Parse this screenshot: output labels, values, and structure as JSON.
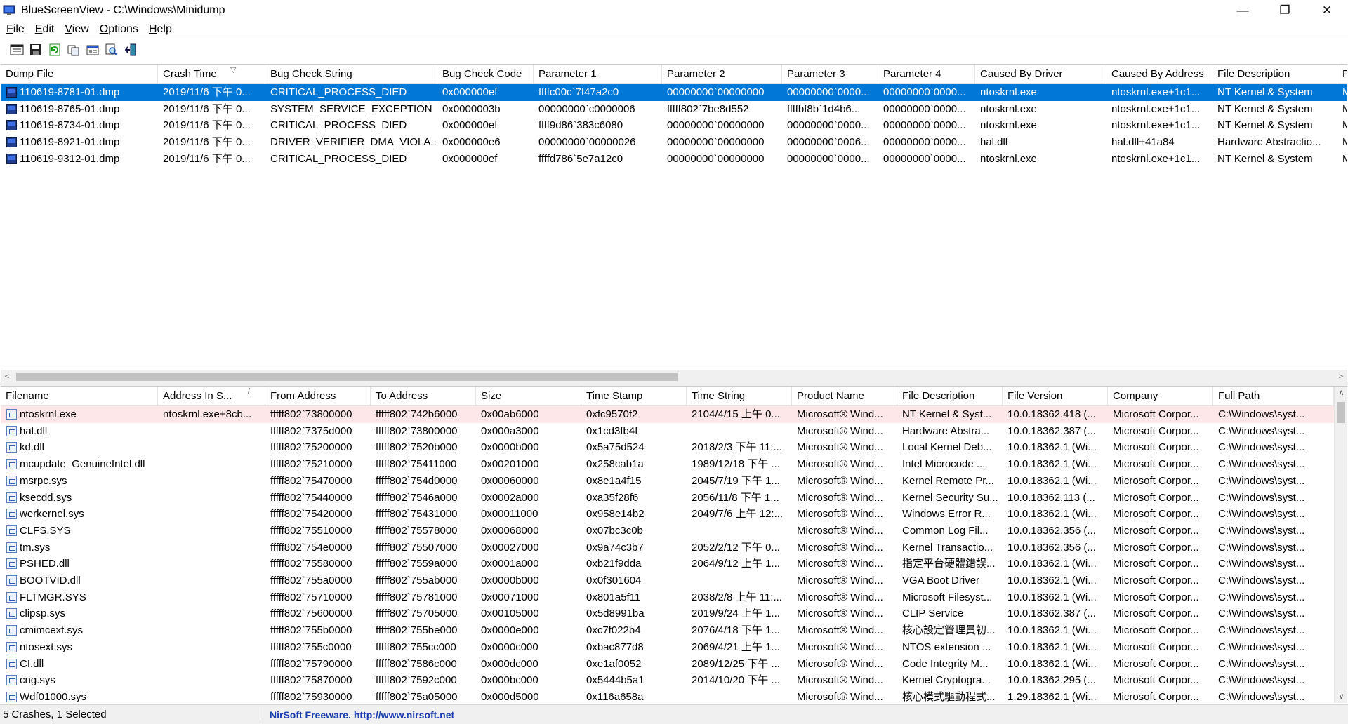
{
  "window": {
    "title": "BlueScreenView  -  C:\\Windows\\Minidump",
    "minimize_glyph": "—",
    "maximize_glyph": "❐",
    "close_glyph": "✕"
  },
  "menu": [
    {
      "mnemonic": "F",
      "rest": "ile"
    },
    {
      "mnemonic": "E",
      "rest": "dit"
    },
    {
      "mnemonic": "V",
      "rest": "iew"
    },
    {
      "mnemonic": "O",
      "rest": "ptions"
    },
    {
      "mnemonic": "H",
      "rest": "elp"
    }
  ],
  "toolbar_icons": [
    "html-report-icon",
    "save-icon",
    "refresh-icon",
    "copy-icon",
    "properties-icon",
    "find-icon",
    "exit-icon"
  ],
  "colors": {
    "selection": "#0078d7",
    "highlight_row": "#fde7e9",
    "link": "#1a3fb0"
  },
  "top_table": {
    "columns": [
      "Dump File",
      "Crash Time",
      "Bug Check String",
      "Bug Check Code",
      "Parameter 1",
      "Parameter 2",
      "Parameter 3",
      "Parameter 4",
      "Caused By Driver",
      "Caused By Address",
      "File Description",
      "P"
    ],
    "sorted_column": "Crash Time",
    "sort_glyph": "▽",
    "rows": [
      [
        "110619-8781-01.dmp",
        "2019/11/6 下午 0...",
        "CRITICAL_PROCESS_DIED",
        "0x000000ef",
        "ffffc00c`7f47a2c0",
        "00000000`00000000",
        "00000000`0000...",
        "00000000`0000...",
        "ntoskrnl.exe",
        "ntoskrnl.exe+1c1...",
        "NT Kernel & System",
        "M"
      ],
      [
        "110619-8765-01.dmp",
        "2019/11/6 下午 0...",
        "SYSTEM_SERVICE_EXCEPTION",
        "0x0000003b",
        "00000000`c0000006",
        "fffff802`7be8d552",
        "ffffbf8b`1d4b6...",
        "00000000`0000...",
        "ntoskrnl.exe",
        "ntoskrnl.exe+1c1...",
        "NT Kernel & System",
        "M"
      ],
      [
        "110619-8734-01.dmp",
        "2019/11/6 下午 0...",
        "CRITICAL_PROCESS_DIED",
        "0x000000ef",
        "ffff9d86`383c6080",
        "00000000`00000000",
        "00000000`0000...",
        "00000000`0000...",
        "ntoskrnl.exe",
        "ntoskrnl.exe+1c1...",
        "NT Kernel & System",
        "M"
      ],
      [
        "110619-8921-01.dmp",
        "2019/11/6 下午 0...",
        "DRIVER_VERIFIER_DMA_VIOLA...",
        "0x000000e6",
        "00000000`00000026",
        "00000000`00000000",
        "00000000`0006...",
        "00000000`0000...",
        "hal.dll",
        "hal.dll+41a84",
        "Hardware Abstractio...",
        "M"
      ],
      [
        "110619-9312-01.dmp",
        "2019/11/6 下午 0...",
        "CRITICAL_PROCESS_DIED",
        "0x000000ef",
        "ffffd786`5e7a12c0",
        "00000000`00000000",
        "00000000`0000...",
        "00000000`0000...",
        "ntoskrnl.exe",
        "ntoskrnl.exe+1c1...",
        "NT Kernel & System",
        "M"
      ]
    ]
  },
  "bottom_table": {
    "columns": [
      "Filename",
      "Address In S...",
      "From Address",
      "To Address",
      "Size",
      "Time Stamp",
      "Time String",
      "Product Name",
      "File Description",
      "File Version",
      "Company",
      "Full Path"
    ],
    "sorted_column": "Address In S...",
    "sort_glyph": "/",
    "rows": [
      [
        "ntoskrnl.exe",
        "ntoskrnl.exe+8cb...",
        "fffff802`73800000",
        "fffff802`742b6000",
        "0x00ab6000",
        "0xfc9570f2",
        "2104/4/15 上午 0...",
        "Microsoft® Wind...",
        "NT Kernel & Syst...",
        "10.0.18362.418 (...",
        "Microsoft Corpor...",
        "C:\\Windows\\syst..."
      ],
      [
        "hal.dll",
        "",
        "fffff802`7375d000",
        "fffff802`73800000",
        "0x000a3000",
        "0x1cd3fb4f",
        "",
        "Microsoft® Wind...",
        "Hardware Abstra...",
        "10.0.18362.387 (...",
        "Microsoft Corpor...",
        "C:\\Windows\\syst..."
      ],
      [
        "kd.dll",
        "",
        "fffff802`75200000",
        "fffff802`7520b000",
        "0x0000b000",
        "0x5a75d524",
        "2018/2/3 下午 11:...",
        "Microsoft® Wind...",
        "Local Kernel Deb...",
        "10.0.18362.1 (Wi...",
        "Microsoft Corpor...",
        "C:\\Windows\\syst..."
      ],
      [
        "mcupdate_GenuineIntel.dll",
        "",
        "fffff802`75210000",
        "fffff802`75411000",
        "0x00201000",
        "0x258cab1a",
        "1989/12/18 下午 ...",
        "Microsoft® Wind...",
        "Intel Microcode ...",
        "10.0.18362.1 (Wi...",
        "Microsoft Corpor...",
        "C:\\Windows\\syst..."
      ],
      [
        "msrpc.sys",
        "",
        "fffff802`75470000",
        "fffff802`754d0000",
        "0x00060000",
        "0x8e1a4f15",
        "2045/7/19 下午 1...",
        "Microsoft® Wind...",
        "Kernel Remote Pr...",
        "10.0.18362.1 (Wi...",
        "Microsoft Corpor...",
        "C:\\Windows\\syst..."
      ],
      [
        "ksecdd.sys",
        "",
        "fffff802`75440000",
        "fffff802`7546a000",
        "0x0002a000",
        "0xa35f28f6",
        "2056/11/8 下午 1...",
        "Microsoft® Wind...",
        "Kernel Security Su...",
        "10.0.18362.113 (...",
        "Microsoft Corpor...",
        "C:\\Windows\\syst..."
      ],
      [
        "werkernel.sys",
        "",
        "fffff802`75420000",
        "fffff802`75431000",
        "0x00011000",
        "0x958e14b2",
        "2049/7/6 上午 12:...",
        "Microsoft® Wind...",
        "Windows Error R...",
        "10.0.18362.1 (Wi...",
        "Microsoft Corpor...",
        "C:\\Windows\\syst..."
      ],
      [
        "CLFS.SYS",
        "",
        "fffff802`75510000",
        "fffff802`75578000",
        "0x00068000",
        "0x07bc3c0b",
        "",
        "Microsoft® Wind...",
        "Common Log Fil...",
        "10.0.18362.356 (...",
        "Microsoft Corpor...",
        "C:\\Windows\\syst..."
      ],
      [
        "tm.sys",
        "",
        "fffff802`754e0000",
        "fffff802`75507000",
        "0x00027000",
        "0x9a74c3b7",
        "2052/2/12 下午 0...",
        "Microsoft® Wind...",
        "Kernel Transactio...",
        "10.0.18362.356 (...",
        "Microsoft Corpor...",
        "C:\\Windows\\syst..."
      ],
      [
        "PSHED.dll",
        "",
        "fffff802`75580000",
        "fffff802`7559a000",
        "0x0001a000",
        "0xb21f9dda",
        "2064/9/12 上午 1...",
        "Microsoft® Wind...",
        "指定平台硬體錯誤...",
        "10.0.18362.1 (Wi...",
        "Microsoft Corpor...",
        "C:\\Windows\\syst..."
      ],
      [
        "BOOTVID.dll",
        "",
        "fffff802`755a0000",
        "fffff802`755ab000",
        "0x0000b000",
        "0x0f301604",
        "",
        "Microsoft® Wind...",
        "VGA Boot Driver",
        "10.0.18362.1 (Wi...",
        "Microsoft Corpor...",
        "C:\\Windows\\syst..."
      ],
      [
        "FLTMGR.SYS",
        "",
        "fffff802`75710000",
        "fffff802`75781000",
        "0x00071000",
        "0x801a5f11",
        "2038/2/8 上午 11:...",
        "Microsoft® Wind...",
        "Microsoft Filesyst...",
        "10.0.18362.1 (Wi...",
        "Microsoft Corpor...",
        "C:\\Windows\\syst..."
      ],
      [
        "clipsp.sys",
        "",
        "fffff802`75600000",
        "fffff802`75705000",
        "0x00105000",
        "0x5d8991ba",
        "2019/9/24 上午 1...",
        "Microsoft® Wind...",
        "CLIP Service",
        "10.0.18362.387 (...",
        "Microsoft Corpor...",
        "C:\\Windows\\syst..."
      ],
      [
        "cmimcext.sys",
        "",
        "fffff802`755b0000",
        "fffff802`755be000",
        "0x0000e000",
        "0xc7f022b4",
        "2076/4/18 下午 1...",
        "Microsoft® Wind...",
        "核心設定管理員初...",
        "10.0.18362.1 (Wi...",
        "Microsoft Corpor...",
        "C:\\Windows\\syst..."
      ],
      [
        "ntosext.sys",
        "",
        "fffff802`755c0000",
        "fffff802`755cc000",
        "0x0000c000",
        "0xbac877d8",
        "2069/4/21 上午 1...",
        "Microsoft® Wind...",
        "NTOS extension ...",
        "10.0.18362.1 (Wi...",
        "Microsoft Corpor...",
        "C:\\Windows\\syst..."
      ],
      [
        "CI.dll",
        "",
        "fffff802`75790000",
        "fffff802`7586c000",
        "0x000dc000",
        "0xe1af0052",
        "2089/12/25 下午 ...",
        "Microsoft® Wind...",
        "Code Integrity M...",
        "10.0.18362.1 (Wi...",
        "Microsoft Corpor...",
        "C:\\Windows\\syst..."
      ],
      [
        "cng.sys",
        "",
        "fffff802`75870000",
        "fffff802`7592c000",
        "0x000bc000",
        "0x5444b5a1",
        "2014/10/20 下午 ...",
        "Microsoft® Wind...",
        "Kernel Cryptogra...",
        "10.0.18362.295 (...",
        "Microsoft Corpor...",
        "C:\\Windows\\syst..."
      ],
      [
        "Wdf01000.sys",
        "",
        "fffff802`75930000",
        "fffff802`75a05000",
        "0x000d5000",
        "0x116a658a",
        "",
        "Microsoft® Wind...",
        "核心模式驅動程式...",
        "1.29.18362.1 (Wi...",
        "Microsoft Corpor...",
        "C:\\Windows\\syst..."
      ]
    ]
  },
  "status": {
    "count": "5 Crashes, 1 Selected",
    "link": "NirSoft Freeware.  http://www.nirsoft.net"
  }
}
